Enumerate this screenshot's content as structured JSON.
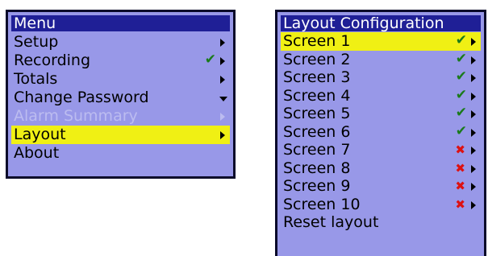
{
  "menu": {
    "title": "Menu",
    "items": [
      {
        "label": "Setup",
        "indicator": "arrow-right",
        "state": "normal"
      },
      {
        "label": "Recording",
        "indicator": "check-arrow",
        "state": "normal"
      },
      {
        "label": "Totals",
        "indicator": "arrow-right",
        "state": "normal"
      },
      {
        "label": "Change Password",
        "indicator": "arrow-down",
        "state": "normal"
      },
      {
        "label": "Alarm Summary",
        "indicator": "arrow-right",
        "state": "disabled"
      },
      {
        "label": "Layout",
        "indicator": "arrow-right",
        "state": "selected"
      },
      {
        "label": "About",
        "indicator": "none",
        "state": "normal"
      }
    ]
  },
  "layout": {
    "title": "Layout Configuration",
    "items": [
      {
        "label": "Screen 1",
        "status": "enabled"
      },
      {
        "label": "Screen 2",
        "status": "enabled"
      },
      {
        "label": "Screen 3",
        "status": "enabled"
      },
      {
        "label": "Screen 4",
        "status": "enabled"
      },
      {
        "label": "Screen 5",
        "status": "enabled"
      },
      {
        "label": "Screen 6",
        "status": "enabled"
      },
      {
        "label": "Screen 7",
        "status": "disabled"
      },
      {
        "label": "Screen 8",
        "status": "disabled"
      },
      {
        "label": "Screen 9",
        "status": "disabled"
      },
      {
        "label": "Screen 10",
        "status": "disabled"
      }
    ],
    "reset_label": "Reset layout"
  },
  "colors": {
    "menu_background": "#9898e8",
    "title_bar": "#1f1f96",
    "selection": "#f0f014",
    "check": "#1a7a1a",
    "cross": "#dd1111",
    "disabled_text": "#bcbcf0"
  },
  "glyphs": {
    "check": "✔",
    "cross": "✖"
  }
}
